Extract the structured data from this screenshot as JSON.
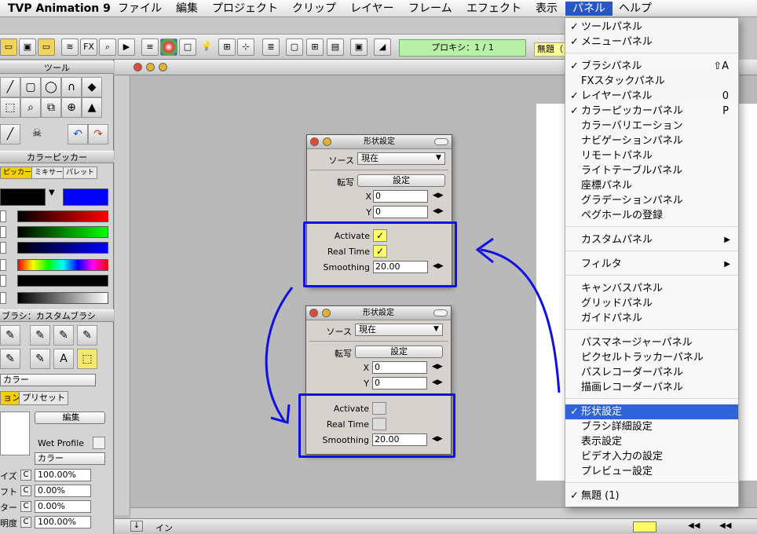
{
  "menubar": {
    "app": "TVP Animation 9",
    "items": [
      "ファイル",
      "編集",
      "プロジェクト",
      "クリップ",
      "レイヤー",
      "フレーム",
      "エフェクト",
      "表示",
      "パネル",
      "ヘルプ"
    ],
    "active": "パネル"
  },
  "toolbar": {
    "fx_label": "FX",
    "proxy": "プロキシ：1 / 1",
    "project_tab": "無題（"
  },
  "left_panel": {
    "tools_title": "ツール",
    "colorpicker_title": "カラーピッカー",
    "color_tabs": [
      "ピッカー",
      "ミキサー",
      "パレット"
    ],
    "brush_title": "ブラシ：カスタムブラシ",
    "color_select": "カラー",
    "tabs2": [
      "ョン",
      "プリセット"
    ],
    "edit_btn": "編集",
    "wet_profile": "Wet Profile",
    "color_select2": "カラー",
    "props": [
      {
        "label": "イズ",
        "c": "C",
        "value": "100.00%"
      },
      {
        "label": "フト",
        "c": "C",
        "value": "0.00%"
      },
      {
        "label": "ター",
        "c": "C",
        "value": "0.00%"
      },
      {
        "label": "明度",
        "c": "C",
        "value": "100.00%"
      }
    ]
  },
  "dialog_top": {
    "title": "形状設定",
    "source_label": "ソース",
    "source_value": "現在",
    "transfer_label": "転写",
    "settings_btn": "設定",
    "x_label": "X",
    "x_value": "0",
    "y_label": "Y",
    "y_value": "0",
    "activate_label": "Activate",
    "realtime_label": "Real Time",
    "smoothing_label": "Smoothing",
    "smoothing_value": "20.00",
    "activate_checked": true,
    "realtime_checked": true
  },
  "dialog_bottom": {
    "title": "形状設定",
    "source_label": "ソース",
    "source_value": "現在",
    "transfer_label": "転写",
    "settings_btn": "設定",
    "x_label": "X",
    "x_value": "0",
    "y_label": "Y",
    "y_value": "0",
    "activate_label": "Activate",
    "realtime_label": "Real Time",
    "smoothing_label": "Smoothing",
    "smoothing_value": "20.00",
    "activate_checked": false,
    "realtime_checked": false
  },
  "panel_menu": [
    {
      "label": "ツールパネル",
      "checked": true
    },
    {
      "label": "メニューパネル",
      "checked": true
    },
    {
      "label": "ブラシパネル",
      "checked": true,
      "shortcut": "⇧A"
    },
    {
      "label": "FXスタックパネル",
      "checked": false
    },
    {
      "label": "レイヤーパネル",
      "checked": true,
      "shortcut": "0"
    },
    {
      "label": "カラーピッカーパネル",
      "checked": true,
      "shortcut": "P"
    },
    {
      "label": "カラーバリエーション",
      "checked": false
    },
    {
      "label": "ナビゲーションパネル",
      "checked": false
    },
    {
      "label": "リモートパネル",
      "checked": false
    },
    {
      "label": "ライトテーブルパネル",
      "checked": false
    },
    {
      "label": "座標パネル",
      "checked": false
    },
    {
      "label": "グラデーションパネル",
      "checked": false
    },
    {
      "label": "ペグホールの登録",
      "checked": false
    },
    {
      "label": "カスタムパネル",
      "submenu": true
    },
    {
      "label": "フィルタ",
      "submenu": true
    },
    {
      "label": "キャンバスパネル"
    },
    {
      "label": "グリッドパネル"
    },
    {
      "label": "ガイドパネル"
    },
    {
      "label": "パスマネージャーパネル"
    },
    {
      "label": "ピクセルトラッカーパネル"
    },
    {
      "label": "パスレコーダーパネル"
    },
    {
      "label": "描画レコーダーパネル"
    },
    {
      "label": "形状設定",
      "checked": true,
      "selected": true
    },
    {
      "label": "ブラシ詳細設定"
    },
    {
      "label": "表示設定"
    },
    {
      "label": "ビデオ入力の設定"
    },
    {
      "label": "プレビュー設定"
    },
    {
      "label": "無題 (1)",
      "checked": true
    }
  ],
  "checkmark": "✓",
  "submenu_arrow": "▶",
  "bottom": {
    "in_label": "イン"
  },
  "colors": {
    "highlight": "#1010e6",
    "menu_select": "#2f63d8",
    "proxy": "#b8f0a8"
  }
}
